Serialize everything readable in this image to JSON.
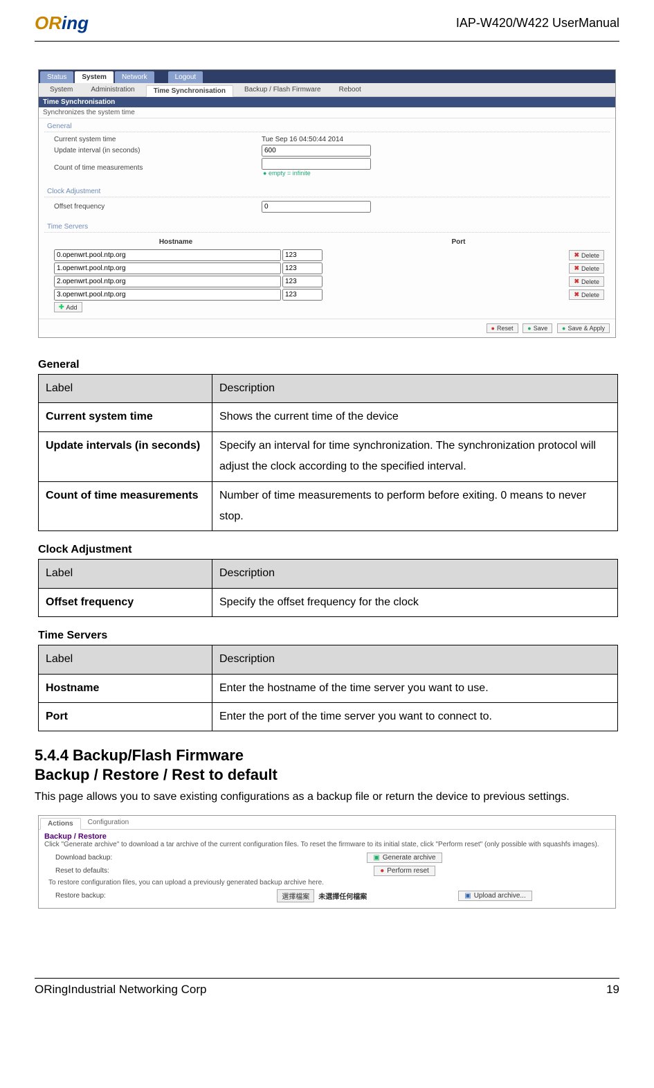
{
  "header": {
    "logo_part1": "OR",
    "logo_part2": "ing",
    "product": "IAP-W420/W422  UserManual"
  },
  "ss1": {
    "maintabs": {
      "t1": "Status",
      "t2": "System",
      "t3": "Network",
      "t4": "Logout"
    },
    "subtabs": {
      "s1": "System",
      "s2": "Administration",
      "s3": "Time Synchronisation",
      "s4": "Backup / Flash Firmware",
      "s5": "Reboot"
    },
    "title": "Time Synchronisation",
    "desc": "Synchronizes the system time",
    "fieldset1": {
      "legend": "General",
      "rows": {
        "r1": {
          "label": "Current system time",
          "value": "Tue Sep 16 04:50:44 2014"
        },
        "r2": {
          "label": "Update interval (in seconds)",
          "value": "600"
        },
        "r3": {
          "label": "Count of time measurements",
          "value": "",
          "hint": "empty = infinite"
        }
      }
    },
    "fieldset2": {
      "legend": "Clock Adjustment",
      "rows": {
        "r1": {
          "label": "Offset frequency",
          "value": "0"
        }
      }
    },
    "fieldset3": {
      "legend": "Time Servers",
      "headers": {
        "h1": "Hostname",
        "h2": "Port"
      },
      "rows": [
        {
          "host": "0.openwrt.pool.ntp.org",
          "port": "123"
        },
        {
          "host": "1.openwrt.pool.ntp.org",
          "port": "123"
        },
        {
          "host": "2.openwrt.pool.ntp.org",
          "port": "123"
        },
        {
          "host": "3.openwrt.pool.ntp.org",
          "port": "123"
        }
      ],
      "delete": "Delete",
      "add": "Add"
    },
    "footer_buttons": {
      "reset": "Reset",
      "save": "Save",
      "apply": "Save & Apply"
    }
  },
  "tables": {
    "general": {
      "title": "General",
      "h1": "Label",
      "h2": "Description",
      "rows": [
        {
          "label": "Current system time",
          "desc": "Shows the current time of the device"
        },
        {
          "label": "Update intervals (in seconds)",
          "desc": "Specify an interval for time synchronization. The synchronization protocol will adjust the clock according to the specified interval."
        },
        {
          "label": "Count of time measurements",
          "desc": "Number of time measurements to perform before exiting. 0 means to never stop."
        }
      ]
    },
    "clock": {
      "title": "Clock Adjustment",
      "h1": "Label",
      "h2": "Description",
      "rows": [
        {
          "label": "Offset frequency",
          "desc": "Specify the offset frequency for the clock"
        }
      ]
    },
    "timeservers": {
      "title": "Time Servers",
      "h1": "Label",
      "h2": "Description",
      "rows": [
        {
          "label": "Hostname",
          "desc": "Enter the hostname of the time server you want to use."
        },
        {
          "label": "Port",
          "desc": "Enter the port of the time server you want to connect to."
        }
      ]
    }
  },
  "section544": {
    "h1": "5.4.4 Backup/Flash Firmware",
    "h2": "Backup / Restore / Rest to default",
    "body": "This page allows you to save existing configurations as a backup file or return the device to previous settings."
  },
  "ss2": {
    "tabs": {
      "t1": "Actions",
      "t2": "Configuration"
    },
    "section_title": "Backup / Restore",
    "hint": "Click \"Generate archive\" to download a tar archive of the current configuration files. To reset the firmware to its initial state, click \"Perform reset\" (only possible with squashfs images).",
    "rows": {
      "download": {
        "label": "Download backup:",
        "button": "Generate archive"
      },
      "reset": {
        "label": "Reset to defaults:",
        "button": "Perform reset"
      },
      "restore": {
        "label": "Restore backup:",
        "filebtn": "選擇檔案",
        "filetxt": "未選擇任何檔案",
        "button": "Upload archive..."
      }
    },
    "note": "To restore configuration files, you can upload a previously generated backup archive here."
  },
  "footer": {
    "left": "ORingIndustrial Networking Corp",
    "right": "19"
  }
}
